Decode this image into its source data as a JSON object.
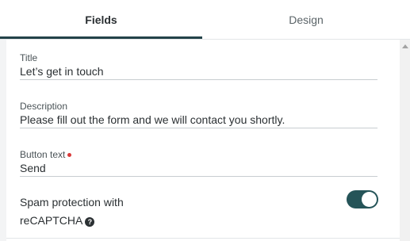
{
  "tabs": {
    "fields": "Fields",
    "design": "Design",
    "active": "Fields"
  },
  "form": {
    "title": {
      "label": "Title",
      "value": "Let’s get in touch"
    },
    "description": {
      "label": "Description",
      "value": "Please fill out the form and we will contact you shortly."
    },
    "button_text": {
      "label": "Button text",
      "value": "Send",
      "required": true
    },
    "spam": {
      "line1": "Spam protection with",
      "line2": "reCAPTCHA",
      "enabled": true
    }
  },
  "colors": {
    "accent": "#255458",
    "required": "#d93a3a"
  },
  "icons": {
    "help": "question-circle-icon"
  }
}
